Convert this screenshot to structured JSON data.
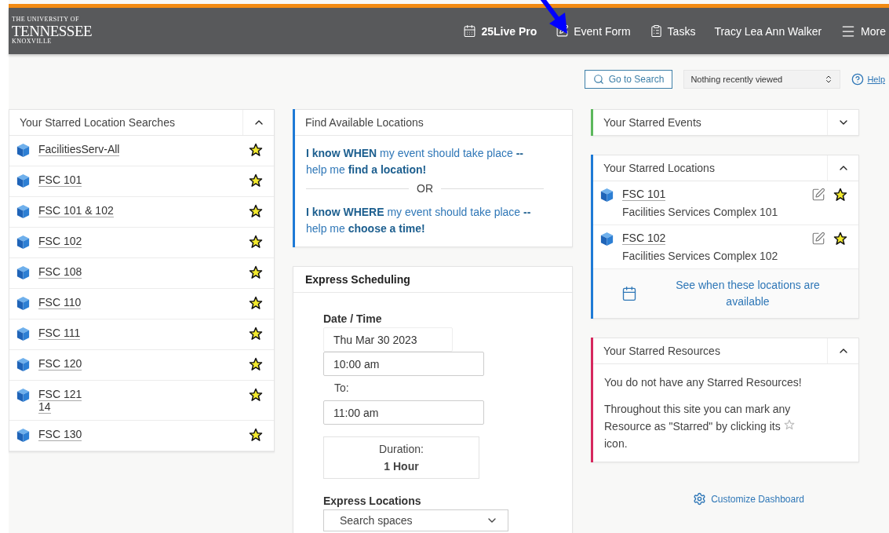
{
  "logo": {
    "lines": [
      "THE UNIVERSITY OF",
      "TENNESSEE",
      "KNOXVILLE"
    ]
  },
  "nav": [
    {
      "kind": "calendar",
      "label": "25Live Pro",
      "bold": true,
      "arrow": false
    },
    {
      "kind": "edit",
      "label": "Event Form",
      "bold": false,
      "arrow": true
    },
    {
      "kind": "clipboard",
      "label": "Tasks",
      "bold": false,
      "arrow": false
    },
    {
      "kind": "user",
      "label": "Tracy Lea Ann Walker",
      "bold": false,
      "arrow": false
    },
    {
      "kind": "menu",
      "label": "More",
      "bold": false,
      "arrow": false
    }
  ],
  "toolbar": {
    "search_button": "Go to Search",
    "recent": "Nothing recently viewed",
    "help": "Help"
  },
  "starred_searches": {
    "title": "Your Starred Location Searches",
    "expanded": true,
    "items": [
      {
        "name": "FacilitiesServ-All",
        "starred": true
      },
      {
        "name": "FSC 101",
        "starred": true
      },
      {
        "name": "FSC 101 & 102",
        "starred": true
      },
      {
        "name": "FSC 102",
        "starred": true
      },
      {
        "name": "FSC 108",
        "starred": true
      },
      {
        "name": "FSC 110",
        "starred": true
      },
      {
        "name": "FSC 111",
        "starred": true
      },
      {
        "name": "FSC 120",
        "starred": true
      },
      {
        "name": "FSC 121\n14",
        "starred": true
      },
      {
        "name": "FSC 130",
        "starred": true
      }
    ]
  },
  "find_locations": {
    "title": "Find Available Locations",
    "when": "**I know WHEN** my event should take place **--** help me **find a location!**",
    "or": "OR",
    "where": "**I know WHERE** my event should take place **--** help me **choose a time!**"
  },
  "express": {
    "title": "Express Scheduling",
    "date_label": "Date / Time",
    "date": "Thu Mar 30 2023",
    "start": "10:00 am",
    "to": "To:",
    "end": "11:00 am",
    "duration_label": "Duration:",
    "duration": "1 Hour",
    "locations_label": "Express Locations",
    "locations_placeholder": "Search spaces"
  },
  "starred_events": {
    "title": "Your Starred Events",
    "expanded": false,
    "color": "#5cb85c"
  },
  "starred_locations": {
    "title": "Your Starred Locations",
    "expanded": true,
    "color": "#1e7ad6",
    "items": [
      {
        "name": "FSC 101",
        "description": "Facilities Services Complex 101",
        "starred": true
      },
      {
        "name": "FSC 102",
        "description": "Facilities Services Complex 102",
        "starred": true
      }
    ],
    "availability_link": "See when these locations are available"
  },
  "starred_resources": {
    "title": "Your Starred Resources",
    "expanded": true,
    "color": "#d6285e",
    "empty": "You do not have any Starred Resources!",
    "hint_before": "Throughout this site you can mark any Resource as \"Starred\" by clicking its",
    "hint_after": "icon."
  },
  "customize": "Customize Dashboard"
}
